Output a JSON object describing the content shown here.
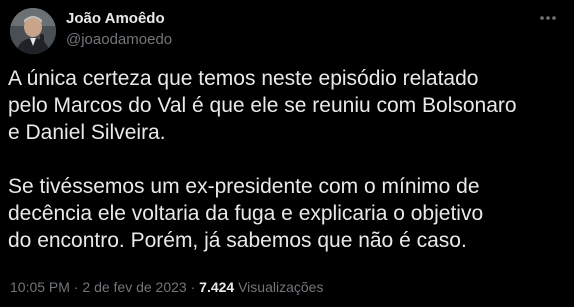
{
  "author": {
    "display_name": "João Amoêdo",
    "handle": "@joaodamoedo",
    "avatar_icon": "user-avatar-photo"
  },
  "actions": {
    "more_icon": "more-horizontal-icon"
  },
  "tweet": {
    "paragraph_1": "A única certeza que temos neste episódio relatado\npelo Marcos do Val é que ele se reuniu com Bolsonaro\ne Daniel Silveira.",
    "paragraph_2": "Se tivéssemos um ex-presidente com o mínimo de\ndecência ele voltaria da fuga e explicaria o objetivo\ndo encontro. Porém, já sabemos que não é caso."
  },
  "meta": {
    "time": "10:05 PM",
    "separator": " · ",
    "date": "2 de fev de 2023",
    "views_count": "7.424",
    "views_label": "Visualizações"
  },
  "colors": {
    "background": "#000000",
    "text_primary": "#e7e9ea",
    "text_secondary": "#71767b"
  }
}
